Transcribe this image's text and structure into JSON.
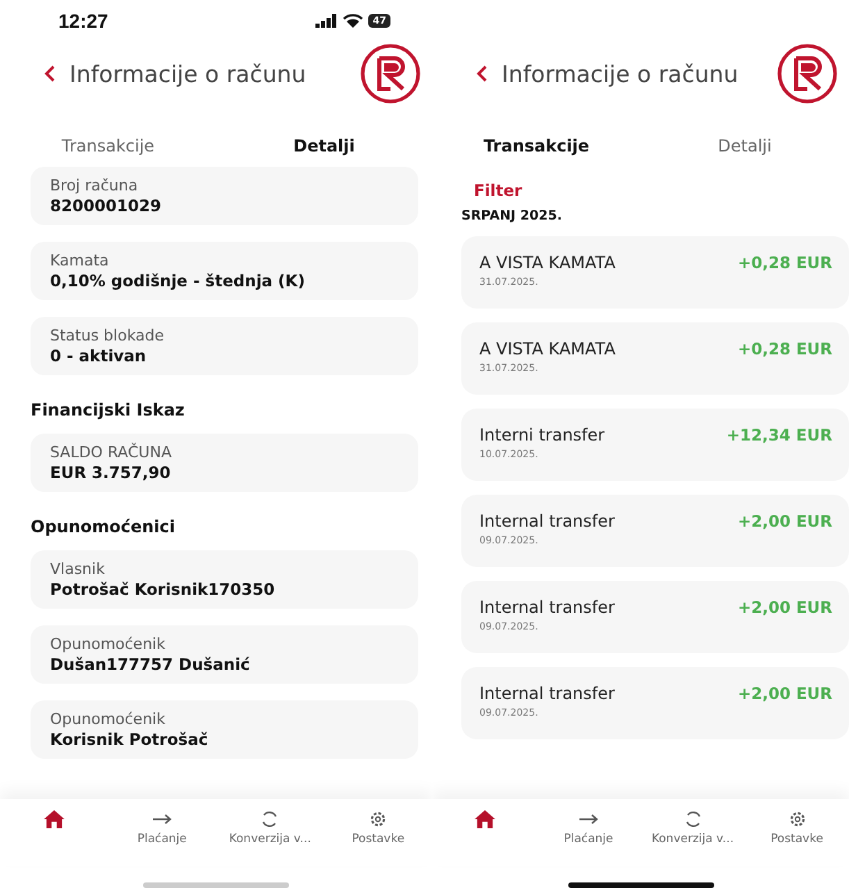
{
  "screens": [
    {
      "kind": "details",
      "status_bar": {
        "time": "12:27",
        "battery": "47"
      },
      "header": {
        "title": "Informacije o računu"
      },
      "tabs": [
        {
          "label": "Transakcije",
          "selected": false
        },
        {
          "label": "Detalji",
          "selected": true
        }
      ],
      "items": [
        {
          "kind": "field",
          "label": "Broj računa",
          "value": "8200001029"
        },
        {
          "kind": "field",
          "label": "Kamata",
          "value": "0,10% godišnje - štednja (K)"
        },
        {
          "kind": "field",
          "label": "Status blokade",
          "value": "0 - aktivan"
        },
        {
          "kind": "heading",
          "text": "Financijski Iskaz"
        },
        {
          "kind": "field",
          "label": "SALDO RAČUNA",
          "value": "EUR 3.757,90"
        },
        {
          "kind": "heading",
          "text": "Opunomoćenici"
        },
        {
          "kind": "field",
          "label": "Vlasnik",
          "value": "Potrošač Korisnik170350"
        },
        {
          "kind": "field",
          "label": "Opunomoćenik",
          "value": "Dušan177757 Dušanić"
        },
        {
          "kind": "field",
          "label": "Opunomoćenik",
          "value": "Korisnik Potrošač"
        }
      ],
      "nav": [
        {
          "selected": true
        },
        {
          "label": "Plaćanje",
          "selected": false
        },
        {
          "label": "Konverzija v...",
          "selected": false
        },
        {
          "label": "Postavke",
          "selected": false
        }
      ]
    },
    {
      "kind": "transactions",
      "header": {
        "title": "Informacije o računu"
      },
      "tabs": [
        {
          "label": "Transakcije",
          "selected": true
        },
        {
          "label": "Detalji",
          "selected": false
        }
      ],
      "filter": "Filter",
      "group": "SRPANJ 2025.",
      "transactions": [
        {
          "title": "A VISTA KAMATA",
          "date": "31.07.2025.",
          "amount": "+0,28 EUR"
        },
        {
          "title": "A VISTA KAMATA",
          "date": "31.07.2025.",
          "amount": "+0,28 EUR"
        },
        {
          "title": "Interni transfer",
          "date": "10.07.2025.",
          "amount": "+12,34 EUR"
        },
        {
          "title": "Internal transfer",
          "date": "09.07.2025.",
          "amount": "+2,00 EUR"
        },
        {
          "title": "Internal transfer",
          "date": "09.07.2025.",
          "amount": "+2,00 EUR"
        },
        {
          "title": "Internal transfer",
          "date": "09.07.2025.",
          "amount": "+2,00 EUR"
        }
      ],
      "nav": [
        {
          "selected": true
        },
        {
          "label": "Plaćanje",
          "selected": false
        },
        {
          "label": "Konverzija v...",
          "selected": false
        },
        {
          "label": "Postavke",
          "selected": false
        }
      ]
    }
  ]
}
